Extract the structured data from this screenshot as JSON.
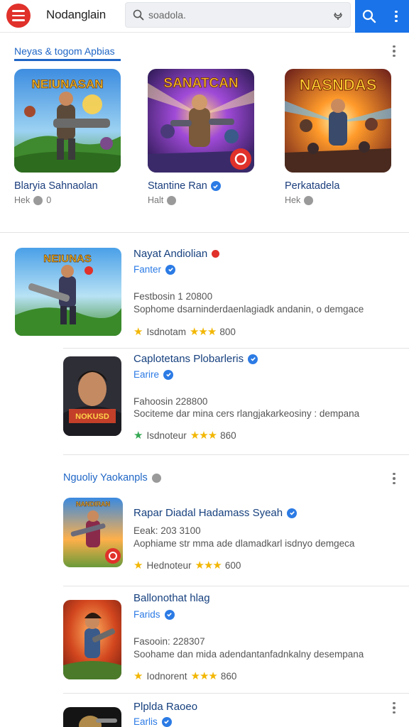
{
  "header": {
    "app_title": "Nodanglain",
    "search_placeholder": "soadola.",
    "icons": [
      "menu-icon",
      "search-icon",
      "mic-icon",
      "more-vert-icon"
    ]
  },
  "featured": {
    "section_title": "Neyas & togom Apbias",
    "cards": [
      {
        "title": "Blaryia Sahnaolan",
        "meta": "Hek",
        "meta_count": "0",
        "art_text": "NEIUNASAN"
      },
      {
        "title": "Stantine Ran",
        "meta": "Halt",
        "meta_count": "",
        "art_text": "SANATCAN"
      },
      {
        "title": "Perkatadela",
        "meta": "Hek",
        "meta_count": "",
        "art_text": "NASNDAS"
      }
    ]
  },
  "list1": [
    {
      "title": "Nayat Andiolian",
      "publisher": "Fanter",
      "line1": "Festbosin 1 20800",
      "line2": "Sophome dsarninderdaenlagiadk andanin, o demgace",
      "rating_label": "Isdnotam",
      "rating_count": "800",
      "art_text": "NEIUNAS"
    },
    {
      "title": "Caplotetans Plobarleris",
      "publisher": "Earire",
      "line1": "Fahoosin 228800",
      "line2": "Sociteme dar mina cers rlangjakarkeosiny : dempana",
      "rating_label": "Isdnoteur",
      "rating_count": "860",
      "art_text": "NOKUSD"
    }
  ],
  "section2": {
    "title": "Nguoliy Yaokanpls"
  },
  "list2": [
    {
      "title": "Rapar Diadal Hadamass Syeah",
      "publisher": "",
      "line1": "Eeak: 203 3100",
      "line2": "Aophiame str mma ade dlamadkarl isdnyo demgeca",
      "rating_label": "Hednoteur",
      "rating_count": "600",
      "art_text": "NANDIRAN"
    },
    {
      "title": "Ballonothat hlag",
      "publisher": "Farids",
      "line1": "Fasooin: 228307",
      "line2": "Soohame dan mida adendantanfadnkalny desempana",
      "rating_label": "Iodnorent",
      "rating_count": "860",
      "art_text": ""
    },
    {
      "title": "Plplda Raoeo",
      "publisher": "Earlis",
      "line1": "",
      "line2": "",
      "rating_label": "",
      "rating_count": "",
      "art_text": ""
    }
  ],
  "colors": {
    "accent": "#1a73e8",
    "brand_red": "#e0312a",
    "title_blue": "#16407e",
    "star": "#f2b705"
  }
}
